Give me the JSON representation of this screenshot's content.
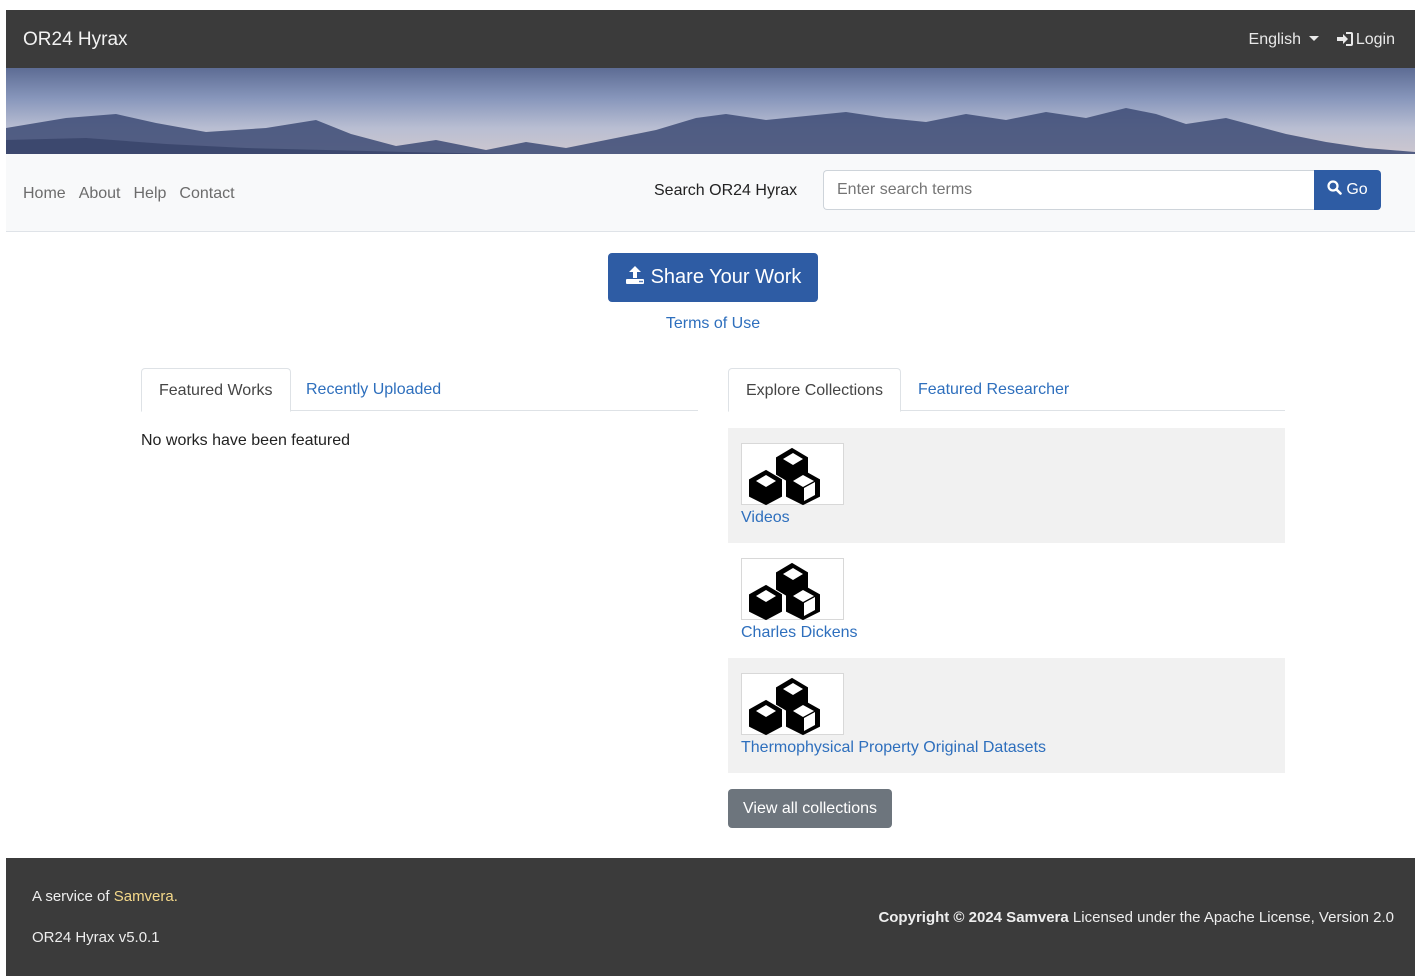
{
  "header": {
    "brand": "OR24 Hyrax",
    "language": "English",
    "login": "Login"
  },
  "nav": {
    "links": [
      "Home",
      "About",
      "Help",
      "Contact"
    ],
    "search_label": "Search OR24 Hyrax",
    "search_placeholder": "Enter search terms",
    "search_button": "Go"
  },
  "hero": {
    "share_button": "Share Your Work",
    "terms_link": "Terms of Use"
  },
  "left_panel": {
    "tabs": [
      "Featured Works",
      "Recently Uploaded"
    ],
    "active_tab": "Featured Works",
    "empty_message": "No works have been featured"
  },
  "right_panel": {
    "tabs": [
      "Explore Collections",
      "Featured Researcher"
    ],
    "active_tab": "Explore Collections",
    "collections": [
      {
        "name": "Videos"
      },
      {
        "name": "Charles Dickens"
      },
      {
        "name": "Thermophysical Property Original Datasets"
      }
    ],
    "view_all_button": "View all collections"
  },
  "footer": {
    "service_prefix": "A service of",
    "service_link": "Samvera.",
    "version": "OR24 Hyrax v5.0.1",
    "copyright_bold": "Copyright © 2024 Samvera",
    "license": "Licensed under the Apache License, Version 2.0"
  },
  "colors": {
    "navbar": "#3b3b3b",
    "primary": "#2e5ca4",
    "link": "#2e6fbd",
    "secondary_button": "#6d757d"
  }
}
